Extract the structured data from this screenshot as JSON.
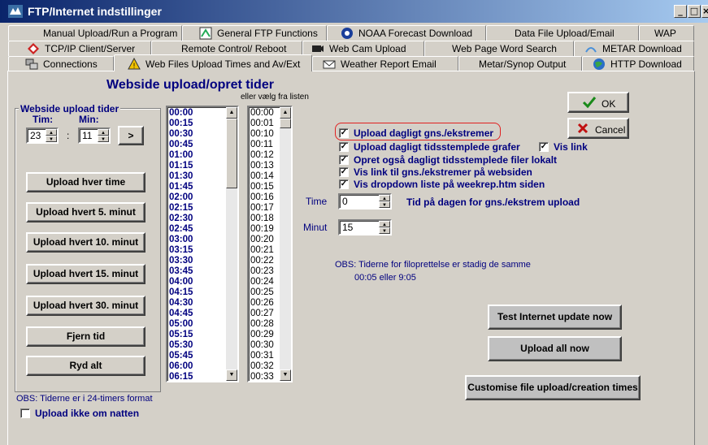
{
  "window": {
    "title": "FTP/Internet indstillinger",
    "controls": {
      "minimize": "_",
      "maximize": "□",
      "close": "×"
    }
  },
  "tabs": {
    "row1": [
      "Manual Upload/Run a Program",
      "General FTP Functions",
      "NOAA Forecast Download",
      "Data File Upload/Email",
      "WAP"
    ],
    "row2": [
      "TCP/IP Client/Server",
      "Remote Control/ Reboot",
      "Web Cam Upload",
      "Web Page Word Search",
      "METAR Download"
    ],
    "row3": [
      "Connections",
      "Web Files Upload Times and  Av/Ext",
      "Weather Report Email",
      "Metar/Synop Output",
      "HTTP Download"
    ]
  },
  "main": {
    "heading": "Webside upload/opret tider",
    "alt_list_label": "eller vælg fra listen",
    "group_title": "Webside upload tider",
    "hour_label": "Tim:",
    "min_label": "Min:",
    "hour_value": "23",
    "colon": ":",
    "min_value": "11",
    "add_button": ">",
    "buttons": [
      "Upload hver time",
      "Upload hvert 5. minut",
      "Upload hvert 10. minut",
      "Upload hvert 15. minut",
      "Upload hvert 30. minut",
      "Fjern tid",
      "Ryd alt"
    ],
    "obs_24h": "OBS: Tiderne er i 24-timers format",
    "no_night_label": "Upload ikke om natten",
    "no_night_checked": false
  },
  "times_list": [
    "00:00",
    "00:15",
    "00:30",
    "00:45",
    "01:00",
    "01:15",
    "01:30",
    "01:45",
    "02:00",
    "02:15",
    "02:30",
    "02:45",
    "03:00",
    "03:15",
    "03:30",
    "03:45",
    "04:00",
    "04:15",
    "04:30",
    "04:45",
    "05:00",
    "05:15",
    "05:30",
    "05:45",
    "06:00",
    "06:15"
  ],
  "minutes_list": [
    "00:00",
    "00:01",
    "00:10",
    "00:11",
    "00:12",
    "00:13",
    "00:14",
    "00:15",
    "00:16",
    "00:17",
    "00:18",
    "00:19",
    "00:20",
    "00:21",
    "00:22",
    "00:23",
    "00:24",
    "00:25",
    "00:26",
    "00:27",
    "00:28",
    "00:29",
    "00:30",
    "00:31",
    "00:32",
    "00:33"
  ],
  "options": {
    "upload_daily_extremes": "Upload dagligt gns./ekstremer",
    "upload_daily_graphs": "Upload dagligt tidsstemplede grafer",
    "show_link": "Vis link",
    "create_local": "Opret også dagligt tidsstemplede filer lokalt",
    "show_link_extremes": "Vis link til gns./ekstremer på websiden",
    "show_dropdown": "Vis dropdown liste på weekrep.htm siden",
    "check_mark": "✓"
  },
  "time_fields": {
    "hour_label": "Time",
    "hour_value": "0",
    "hour_desc": "Tid på dagen for gns./ekstrem upload",
    "minute_label": "Minut",
    "minute_value": "15"
  },
  "notes": {
    "line1": "OBS: Tiderne for filoprettelse er stadig de samme",
    "line2": "00:05 eller 9:05"
  },
  "actions": {
    "ok": "OK",
    "cancel": "Cancel",
    "test": "Test Internet update now",
    "upload_all": "Upload all now",
    "customise": "Customise file upload/creation times"
  },
  "colors": {
    "title_start": "#0a246a",
    "title_end": "#a6caf0",
    "label_blue": "#00007f",
    "highlight_red": "#e02020",
    "ok_green": "#1a8a1a",
    "cancel_red": "#c01010"
  }
}
